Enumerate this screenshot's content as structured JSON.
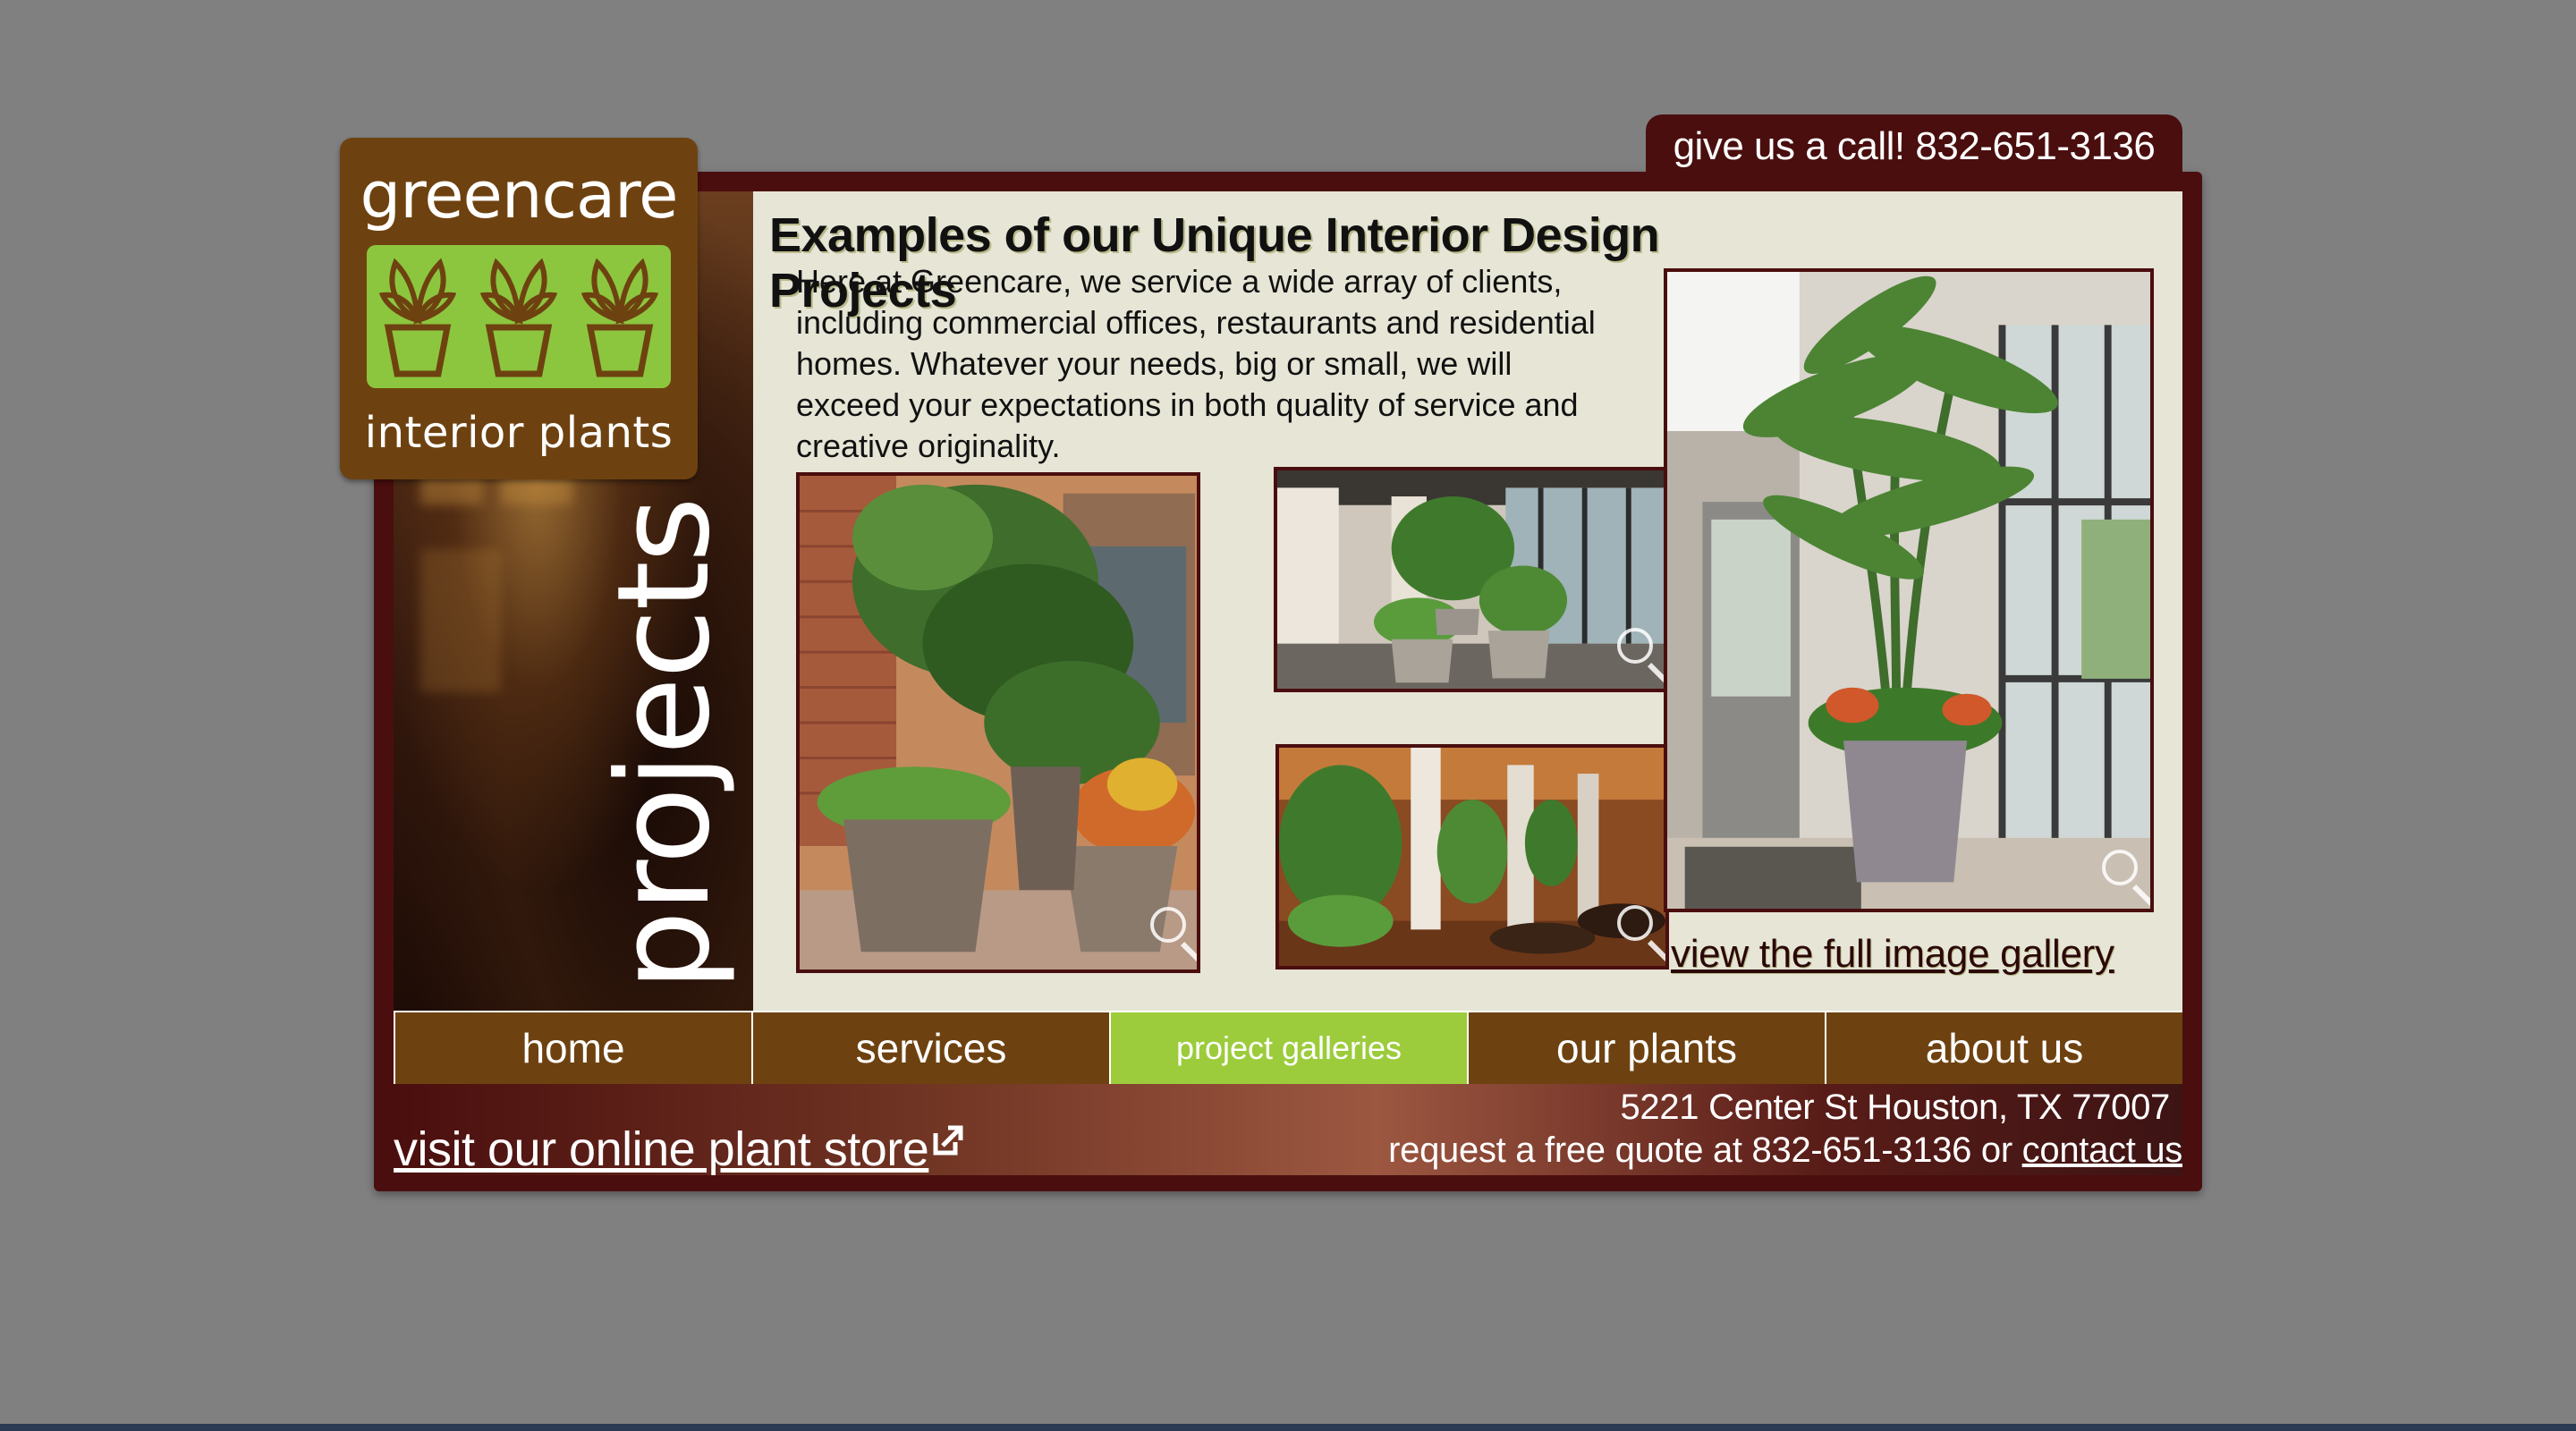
{
  "header": {
    "phone_prompt": "give us a call! 832-651-3136"
  },
  "logo": {
    "top_text": "greencare",
    "bottom_text": "interior plants",
    "plant_icons": [
      "potted-plant-icon",
      "potted-plant-icon",
      "potted-plant-icon"
    ]
  },
  "side": {
    "section_label": "projects"
  },
  "main": {
    "title": "Examples of our Unique Interior Design Projects",
    "intro": "Here at Greencare, we service a wide array of clients, including commercial offices, restaurants and residential homes. Whatever your needs, big or small, we will exceed your expectations in both quality of service and creative originality.",
    "gallery_link": "view the full image gallery",
    "photos": [
      {
        "name": "photo-courtyard-pots",
        "icon": "magnifier-icon"
      },
      {
        "name": "photo-lobby-planters",
        "icon": "magnifier-icon"
      },
      {
        "name": "photo-restaurant-interior",
        "icon": "magnifier-icon"
      },
      {
        "name": "photo-palm-entryway",
        "icon": "magnifier-icon"
      }
    ]
  },
  "nav": {
    "items": [
      {
        "label": "home",
        "active": false
      },
      {
        "label": "services",
        "active": false
      },
      {
        "label": "project galleries",
        "active": true
      },
      {
        "label": "our plants",
        "active": false
      },
      {
        "label": "about us",
        "active": false
      }
    ]
  },
  "footer": {
    "store_link": "visit our online plant store",
    "store_icon": "external-link-icon",
    "address": "5221 Center St Houston, TX 77007",
    "quote_prefix": "request a free quote at 832-651-3136 or",
    "contact_link": "contact us"
  },
  "colors": {
    "page_bg": "#808080",
    "frame": "#4a0e0e",
    "brown": "#6e4210",
    "green": "#8cc63f",
    "nav_active": "#9ccc3b",
    "panel": "#e6e5d6"
  }
}
